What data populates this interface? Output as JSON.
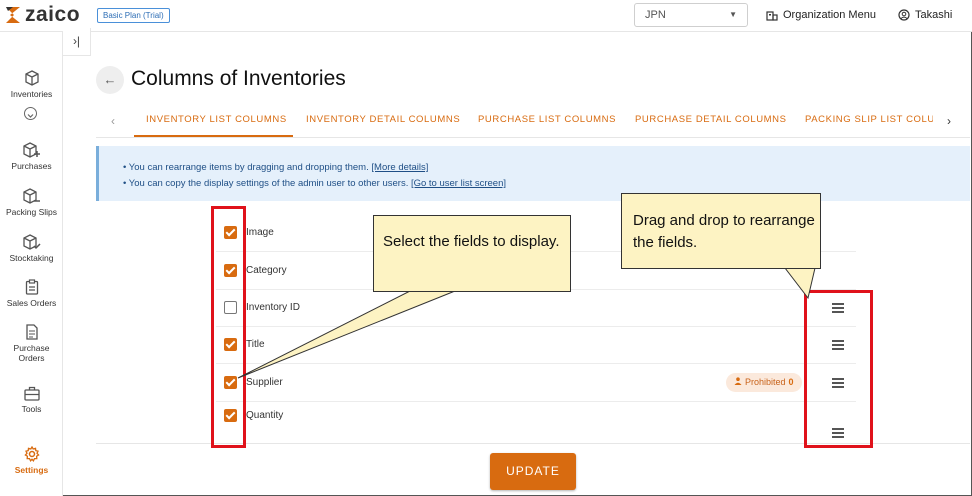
{
  "app": {
    "logo_text": "zaico",
    "plan_badge": "Basic Plan (Trial)",
    "language": "JPN",
    "org_menu": "Organization Menu",
    "user_name": "Takashi"
  },
  "sidebar": {
    "collapse_icon": "›|",
    "items": [
      {
        "label": "Inventories",
        "icon": "box-icon"
      },
      {
        "label": "Purchases",
        "icon": "box-plus-icon"
      },
      {
        "label": "Packing Slips",
        "icon": "box-minus-icon"
      },
      {
        "label": "Stocktaking",
        "icon": "box-check-icon"
      },
      {
        "label": "Sales Orders",
        "icon": "clipboard-icon"
      },
      {
        "label": "Purchase Orders",
        "icon": "document-icon"
      },
      {
        "label": "Tools",
        "icon": "toolbox-icon"
      },
      {
        "label": "Settings",
        "icon": "gear-icon",
        "active": true
      }
    ]
  },
  "page": {
    "back_icon": "←",
    "title": "Columns of Inventories"
  },
  "tabs": [
    {
      "label": "INVENTORY LIST COLUMNS",
      "active": true
    },
    {
      "label": "INVENTORY DETAIL COLUMNS"
    },
    {
      "label": "PURCHASE LIST COLUMNS"
    },
    {
      "label": "PURCHASE DETAIL COLUMNS"
    },
    {
      "label": "PACKING SLIP LIST COLUMNS"
    }
  ],
  "info": {
    "line1_text": "• You can rearrange items by dragging and dropping them. ",
    "line1_link": "[More details]",
    "line2_text": "• You can copy the display settings of the admin user to other users. ",
    "line2_link": "[Go to user list screen]"
  },
  "fields": [
    {
      "label": "Image",
      "checked": true
    },
    {
      "label": "Category",
      "checked": true
    },
    {
      "label": "Inventory ID",
      "checked": false
    },
    {
      "label": "Title",
      "checked": true
    },
    {
      "label": "Supplier",
      "checked": true
    },
    {
      "label": "Quantity",
      "checked": true
    }
  ],
  "supplier_badge": {
    "label": "Prohibited",
    "count": "0"
  },
  "update_button": "UPDATE",
  "annotations": {
    "select_callout": "Select the fields to display.",
    "drag_callout": "Drag and drop to rearrange the fields."
  },
  "colors": {
    "accent": "#d86b10",
    "annotation_red": "#e0121b",
    "callout_bg": "#fdf3c3",
    "info_bg": "#e5f0fb"
  }
}
